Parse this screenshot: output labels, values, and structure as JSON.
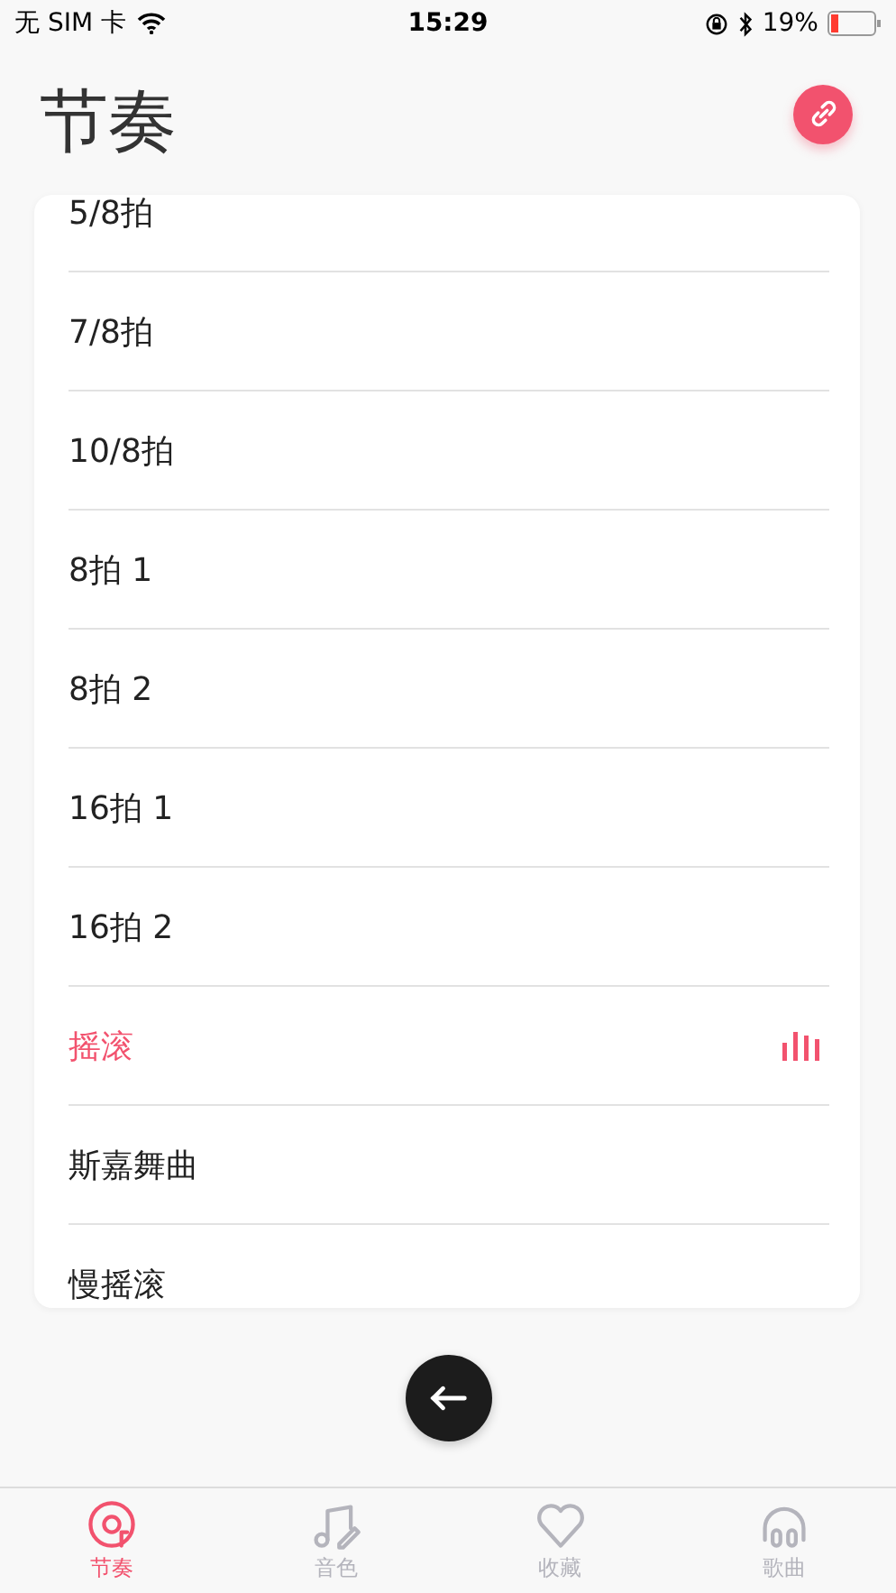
{
  "status_bar": {
    "carrier": "无 SIM 卡",
    "time": "15:29",
    "battery": "19%"
  },
  "header": {
    "title": "节奏"
  },
  "rhythms": [
    {
      "label": "5/8拍",
      "selected": false
    },
    {
      "label": "7/8拍",
      "selected": false
    },
    {
      "label": "10/8拍",
      "selected": false
    },
    {
      "label": "8拍 1",
      "selected": false
    },
    {
      "label": "8拍 2",
      "selected": false
    },
    {
      "label": "16拍 1",
      "selected": false
    },
    {
      "label": "16拍 2",
      "selected": false
    },
    {
      "label": "摇滚",
      "selected": true
    },
    {
      "label": "斯嘉舞曲",
      "selected": false
    },
    {
      "label": "慢摇滚",
      "selected": false
    }
  ],
  "tabs": [
    {
      "label": "节奏",
      "kind": "disc",
      "selected": true
    },
    {
      "label": "音色",
      "kind": "note",
      "selected": false
    },
    {
      "label": "收藏",
      "kind": "heart",
      "selected": false
    },
    {
      "label": "歌曲",
      "kind": "headphones",
      "selected": false
    }
  ]
}
